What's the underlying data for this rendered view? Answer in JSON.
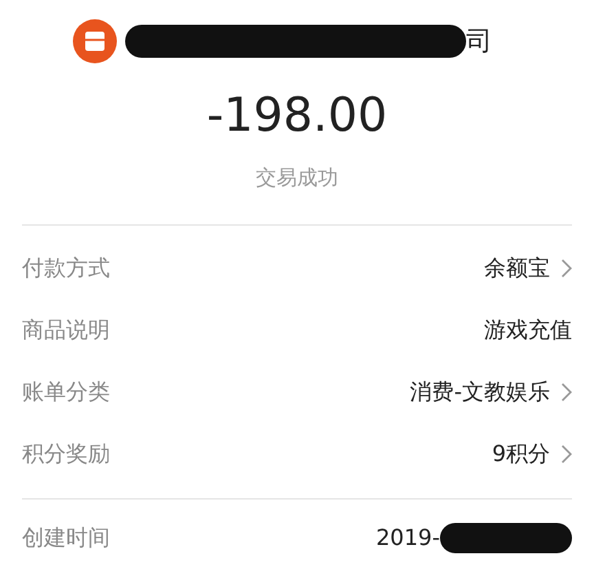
{
  "merchant": {
    "name_visible": "司",
    "redacted": true
  },
  "amount": "-198.00",
  "status": "交易成功",
  "details": [
    {
      "label": "付款方式",
      "value": "余额宝",
      "link": true
    },
    {
      "label": "商品说明",
      "value": "游戏充值",
      "link": false
    },
    {
      "label": "账单分类",
      "value": "消费-文教娱乐",
      "link": true
    },
    {
      "label": "积分奖励",
      "value": "9积分",
      "link": true
    }
  ],
  "created": {
    "label": "创建时间",
    "value_visible": "2019-",
    "redacted": true
  }
}
